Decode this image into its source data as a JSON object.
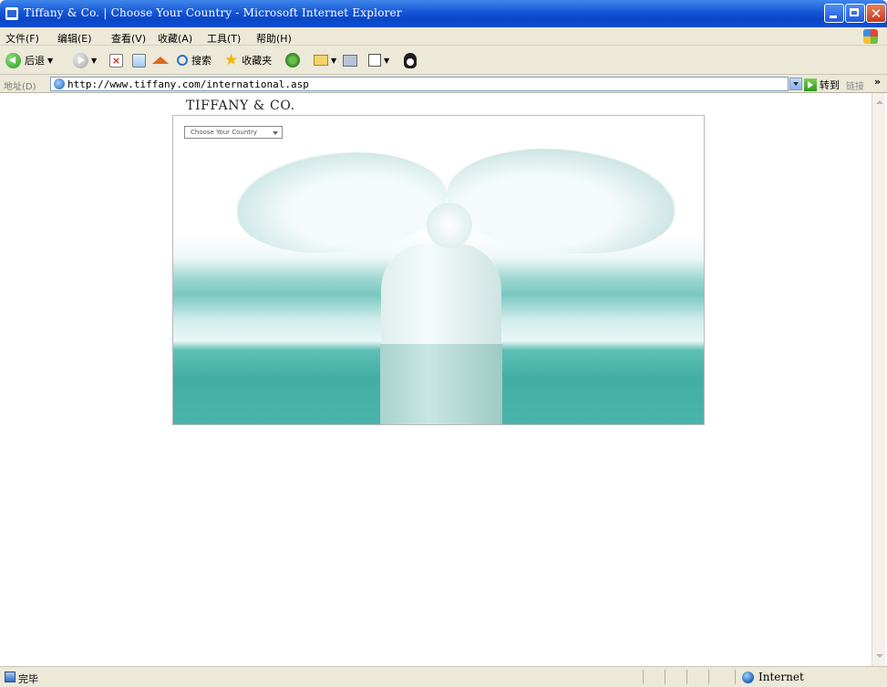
{
  "window": {
    "title": "Tiffany & Co.  | Choose Your Country - Microsoft Internet Explorer"
  },
  "menu": [
    "文件(F)",
    "编辑(E)",
    "查看(V)",
    "收藏(A)",
    "工具(T)",
    "帮助(H)"
  ],
  "toolbar": {
    "back_label": "后退",
    "search_label": "搜索",
    "favorites_label": "收藏夹"
  },
  "address": {
    "label": "地址(D)",
    "url": "http://www.tiffany.com/international.asp",
    "go_label": "转到",
    "links_label": "链接"
  },
  "page": {
    "brand": "TIFFANY & CO.",
    "country_select": "Choose Your Country"
  },
  "status": {
    "text": "完毕",
    "zone": "Internet"
  },
  "colors": {
    "titlebar": "#0a46c8",
    "chrome": "#ece9d8",
    "tiffany_blue": "#49b4aa"
  }
}
